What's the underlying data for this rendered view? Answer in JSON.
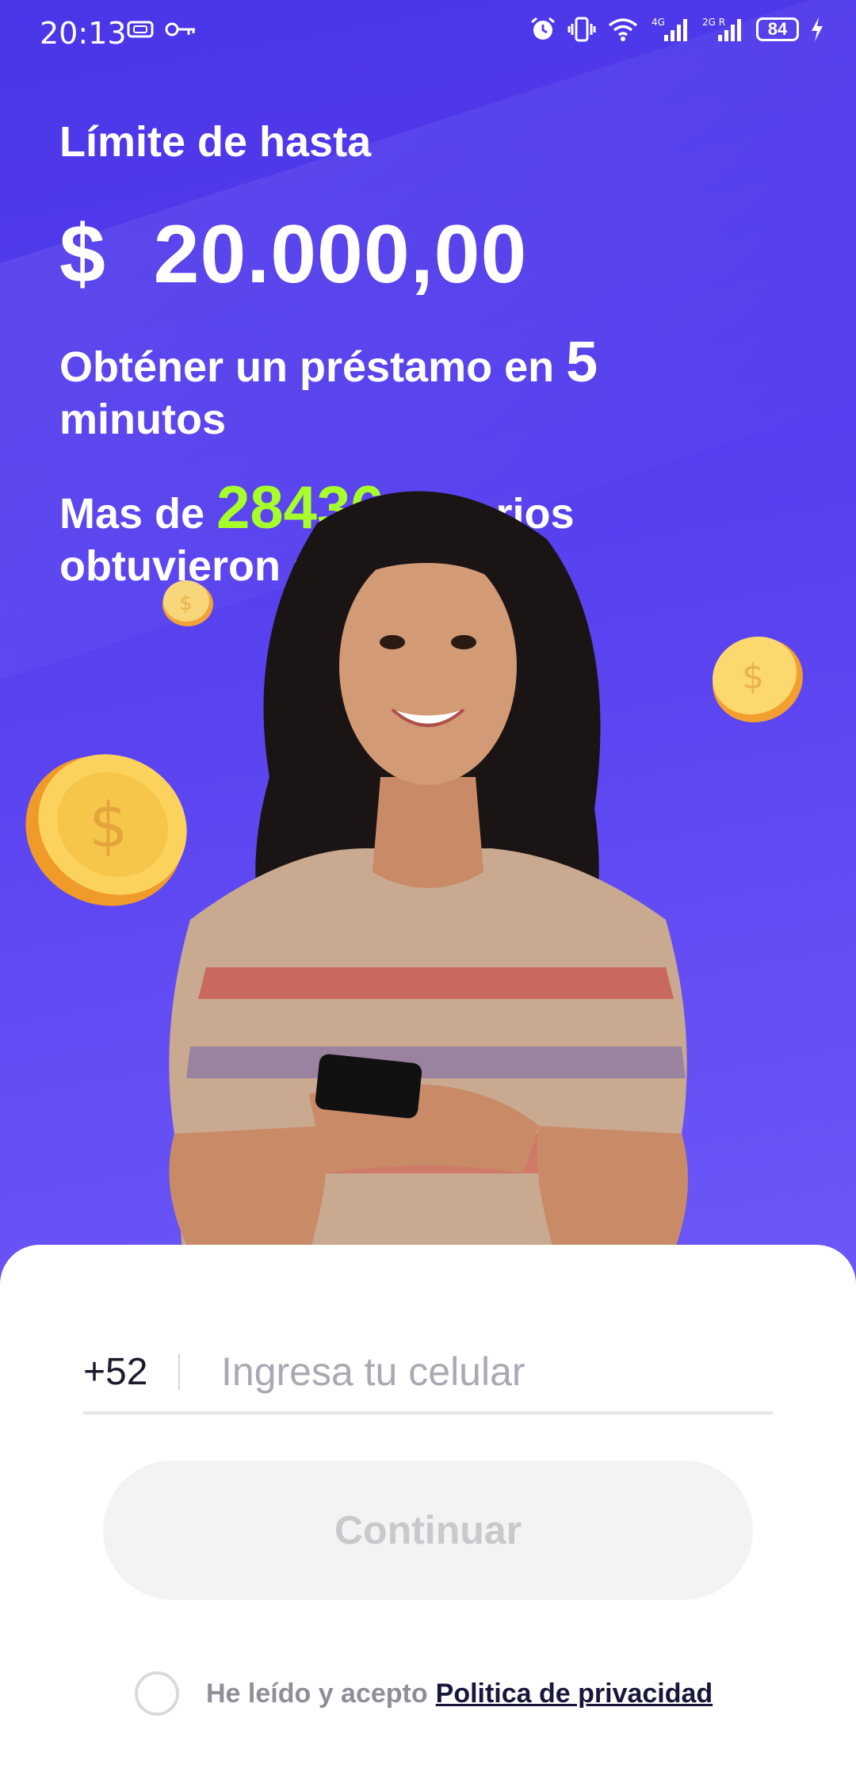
{
  "status_bar": {
    "time": "20:13",
    "battery": "84",
    "icons": [
      "sim-card-icon",
      "key-icon",
      "alarm-icon",
      "vibrate-icon",
      "wifi-icon",
      "signal-4g-icon",
      "signal-2g-icon",
      "battery-icon",
      "charging-icon"
    ]
  },
  "hero": {
    "line1": "Límite de hasta",
    "amount": "$  20.000,00",
    "line3_prefix": "Obténer un préstamo en ",
    "line3_number": "5",
    "line3_suffix": "minutos",
    "line4_prefix": "Mas de ",
    "line4_count": "28436",
    "line4_suffix": " usuarios",
    "line4_line2": "obtuvieron su prestamo"
  },
  "colors": {
    "background": "#5841ef",
    "highlight": "#a6ff2a",
    "button_bg": "#f3f3f5",
    "button_text": "#c8c8cd"
  },
  "form": {
    "country_code": "+52",
    "phone_placeholder": "Ingresa tu celular",
    "phone_value": "",
    "continue_label": "Continuar",
    "agree_text": "He leído y acepto",
    "policy_link": "Politica de privacidad",
    "agree_checked": false
  }
}
